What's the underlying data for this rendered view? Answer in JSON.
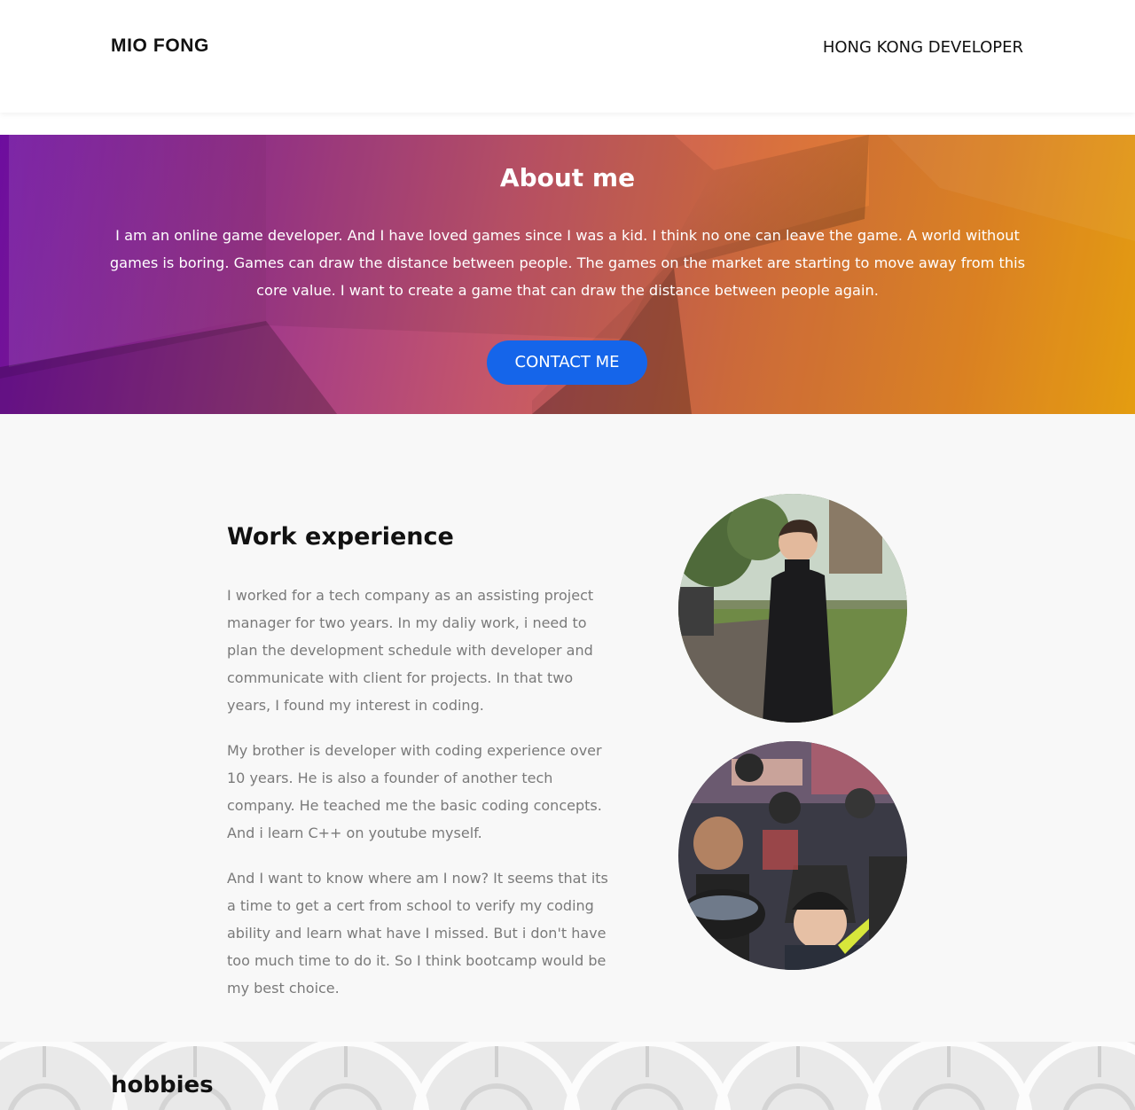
{
  "header": {
    "brand": "MIO FONG",
    "tagline": "HONG KONG DEVELOPER"
  },
  "about": {
    "title": "About me",
    "text": "I am an online game developer. And I have loved games since I was a kid. I think no one can leave the game. A world without games is boring. Games can draw the distance between people. The games on the market are starting to move away from this core value. I want to create a game that can draw the distance between people again.",
    "contact_label": "CONTACT ME"
  },
  "work": {
    "title": "Work experience",
    "paragraphs": [
      "I worked for a tech company as an assisting project manager for two years. In my daliy work, i need to plan the development schedule with developer and communicate with client for projects. In that two years, I found my interest in coding.",
      "My brother is developer with coding experience over 10 years. He is also a founder of another tech company. He teached me the basic coding concepts. And i learn C++ on youtube myself.",
      "And I want to know where am I now? It seems that its a time to get a cert from school to verify my coding ability and learn what have I missed. But i don't have too much time to do it. So I think bootcamp would be my best choice."
    ]
  },
  "hobbies": {
    "title": "hobbies"
  },
  "colors": {
    "contact_button": "#1565ea",
    "hero_start": "#7a0fb0",
    "hero_end": "#f3a712",
    "work_background": "#f8f8f8",
    "body_text": "#7a7a7a"
  }
}
